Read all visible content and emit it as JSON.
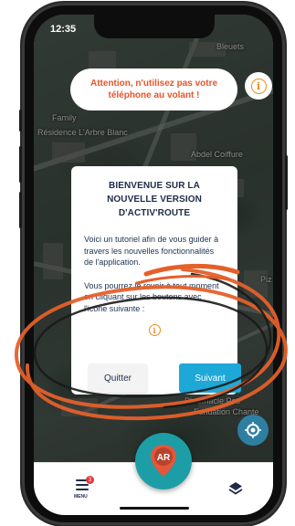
{
  "status_bar": {
    "time": "12:35"
  },
  "map": {
    "labels": [
      "Family",
      "Résidence L'Arbre Blanc",
      "Abdel Coiffure",
      "Pharmacie Pes",
      "Fondation Chante",
      "Piz",
      "Bleuets"
    ]
  },
  "warning": {
    "text": "Attention, n'utilisez pas votre téléphone au volant !",
    "color": "#e8542a"
  },
  "dialog": {
    "title": "BIENVENUE SUR LA NOUVELLE VERSION D'ACTIV'ROUTE",
    "paragraph1": "Voici un tutoriel afin de vous guider à travers les nouvelles fonctionnalités de l'application.",
    "paragraph2": "Vous pourrez le revoir à tout moment en cliquant sur les boutons avec l'icône suivante :",
    "quit_label": "Quitter",
    "next_label": "Suivant",
    "next_color": "#1ea8d8"
  },
  "bottom_bar": {
    "menu_label": "MENU",
    "menu_badge": "3",
    "ar_label": "AR"
  },
  "icons": {
    "info": "info-circle-icon",
    "layers": "layers-icon",
    "locate": "locate-icon",
    "menu": "hamburger-icon"
  },
  "colors": {
    "accent_orange": "#f08a1c",
    "ar_teal": "#1d9ea7",
    "annotation_orange": "#e4602a"
  }
}
